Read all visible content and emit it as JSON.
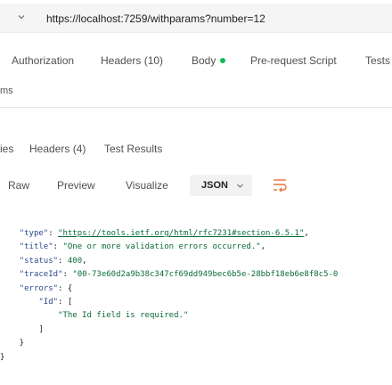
{
  "request": {
    "url": "https://localhost:7259/withparams?number=12",
    "tabs": [
      {
        "label": "Authorization"
      },
      {
        "label": "Headers (10)"
      },
      {
        "label": "Body"
      },
      {
        "label": "Pre-request Script"
      },
      {
        "label": "Tests"
      }
    ],
    "params_label": "ms"
  },
  "response": {
    "tabs": [
      {
        "label": "ies"
      },
      {
        "label": "Headers (4)"
      },
      {
        "label": "Test Results"
      }
    ],
    "format_tabs": [
      {
        "label": "Raw"
      },
      {
        "label": "Preview"
      },
      {
        "label": "Visualize"
      }
    ],
    "format_select": "JSON",
    "body": {
      "type_key": "\"type\"",
      "type_val": "\"https://tools.ietf.org/html/rfc7231#section-6.5.1\"",
      "title_key": "\"title\"",
      "title_val": "\"One or more validation errors occurred.\"",
      "status_key": "\"status\"",
      "status_val": "400",
      "traceid_key": "\"traceId\"",
      "traceid_val": "\"00-73e60d2a9b38c347cf69dd949bec6b5e-28bbf18eb6e8f8c5-0",
      "errors_key": "\"errors\"",
      "id_key": "\"Id\"",
      "error_msg": "\"The Id field is required.\""
    }
  },
  "colors": {
    "body_dot": "#0cbb52",
    "json_key": "#2a4b8d",
    "json_string": "#0b6b3a"
  }
}
